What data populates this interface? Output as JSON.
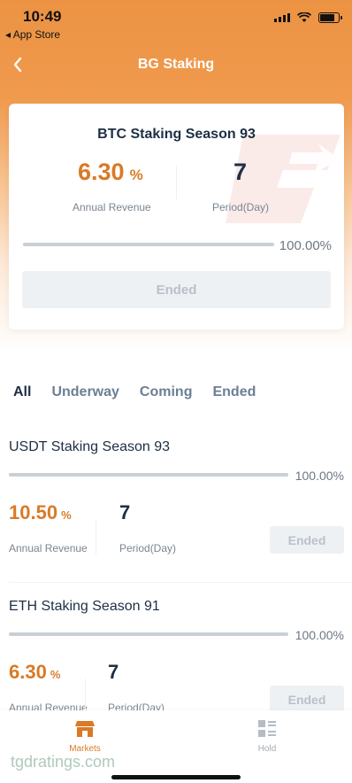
{
  "status_bar": {
    "time": "10:49",
    "back_label": "◂ App Store"
  },
  "nav": {
    "title": "BG Staking"
  },
  "featured": {
    "title": "BTC Staking Season 93",
    "annual_revenue": "6.30",
    "percent_sign": "%",
    "annual_revenue_label": "Annual Revenue",
    "period": "7",
    "period_label": "Period(Day)",
    "progress_fraction": 1.0,
    "progress_text": "100.00%",
    "button_label": "Ended"
  },
  "tabs": [
    {
      "label": "All",
      "active": true
    },
    {
      "label": "Underway",
      "active": false
    },
    {
      "label": "Coming",
      "active": false
    },
    {
      "label": "Ended",
      "active": false
    }
  ],
  "items": [
    {
      "title": "USDT Staking Season 93",
      "progress_fraction": 1.0,
      "progress_text": "100.00%",
      "annual_revenue": "10.50",
      "percent_sign": "%",
      "annual_revenue_label": "Annual Revenue",
      "period": "7",
      "period_label": "Period(Day)",
      "button_label": "Ended"
    },
    {
      "title": "ETH Staking Season 91",
      "progress_fraction": 1.0,
      "progress_text": "100.00%",
      "annual_revenue": "6.30",
      "percent_sign": "%",
      "annual_revenue_label": "Annual Revenue",
      "period": "7",
      "period_label": "Period(Day)",
      "button_label": "Ended"
    }
  ],
  "bottom_nav": {
    "markets_label": "Markets",
    "hold_label": "Hold",
    "active": "Markets"
  },
  "watermark_text": "tgdratings.com",
  "colors": {
    "accent": "#d97a26",
    "header_orange": "#ec9343",
    "text_dark": "#1d2f45",
    "muted": "#7a8591"
  }
}
